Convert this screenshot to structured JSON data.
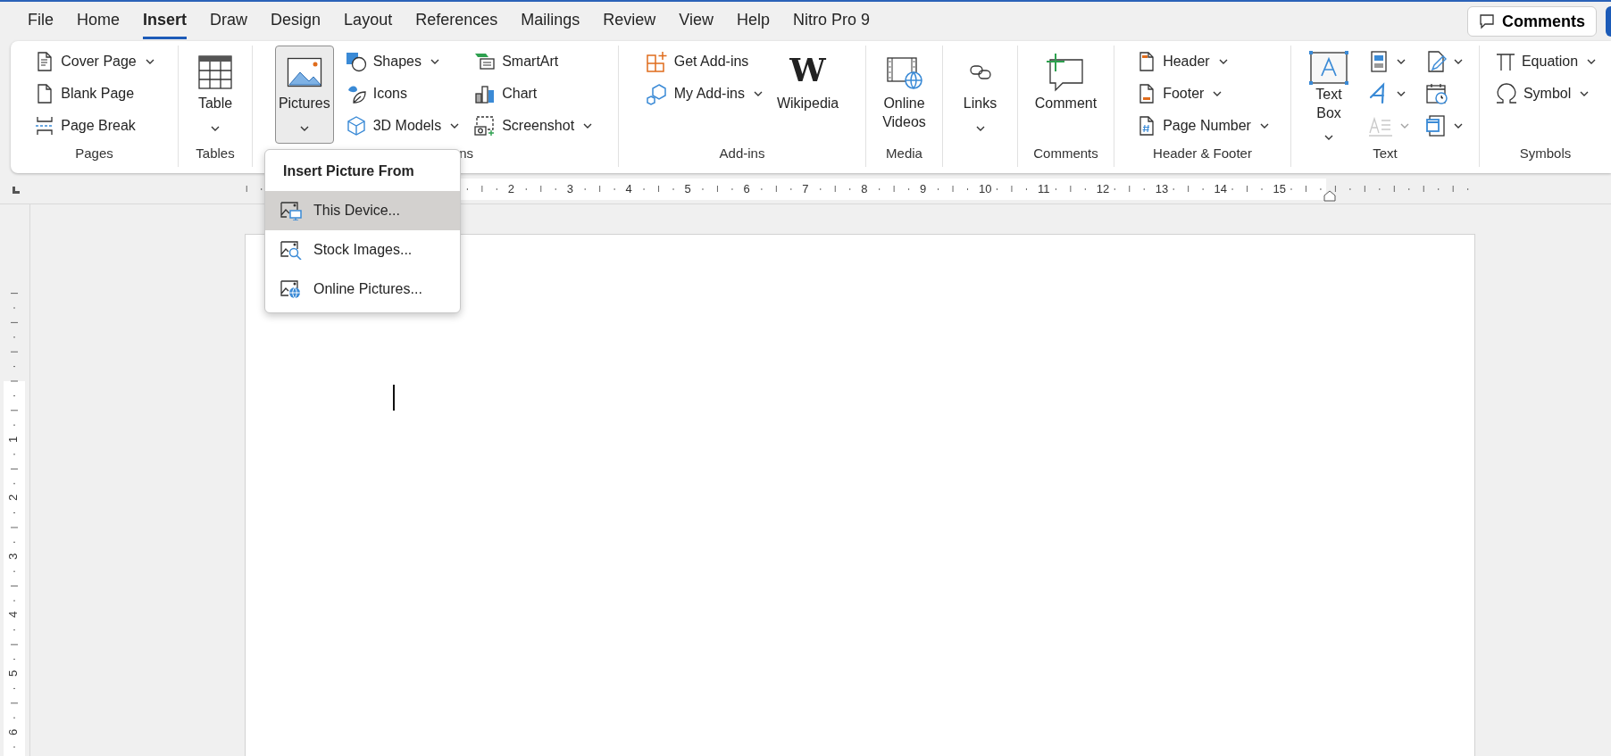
{
  "tabs": [
    {
      "label": "File",
      "selected": false
    },
    {
      "label": "Home",
      "selected": false
    },
    {
      "label": "Insert",
      "selected": true
    },
    {
      "label": "Draw",
      "selected": false
    },
    {
      "label": "Design",
      "selected": false
    },
    {
      "label": "Layout",
      "selected": false
    },
    {
      "label": "References",
      "selected": false
    },
    {
      "label": "Mailings",
      "selected": false
    },
    {
      "label": "Review",
      "selected": false
    },
    {
      "label": "View",
      "selected": false
    },
    {
      "label": "Help",
      "selected": false
    },
    {
      "label": "Nitro Pro 9",
      "selected": false
    }
  ],
  "comments_button": "Comments",
  "ribbon_groups": [
    {
      "label": "Pages",
      "columns": [
        [
          {
            "kind": "small",
            "label": "Cover Page",
            "dropdown": true
          },
          {
            "kind": "small",
            "label": "Blank Page",
            "dropdown": false
          },
          {
            "kind": "small",
            "label": "Page Break",
            "dropdown": false
          }
        ]
      ]
    },
    {
      "label": "Tables",
      "columns": [
        [
          {
            "kind": "large",
            "label": "Table",
            "dropdown": true,
            "pressed": false
          }
        ]
      ]
    },
    {
      "label": "ns",
      "columns": [
        [
          {
            "kind": "large",
            "label": "Pictures",
            "dropdown": true,
            "pressed": true
          }
        ],
        [
          {
            "kind": "small",
            "label": "Shapes",
            "dropdown": true
          },
          {
            "kind": "small",
            "label": "Icons",
            "dropdown": false
          },
          {
            "kind": "small",
            "label": "3D Models",
            "dropdown": true
          }
        ],
        [
          {
            "kind": "small",
            "label": "SmartArt",
            "dropdown": false
          },
          {
            "kind": "small",
            "label": "Chart",
            "dropdown": false
          },
          {
            "kind": "small",
            "label": "Screenshot",
            "dropdown": true
          }
        ]
      ]
    },
    {
      "label": "Add-ins",
      "columns": [
        [
          {
            "kind": "small",
            "label": "Get Add-ins",
            "dropdown": false
          },
          {
            "kind": "small",
            "label": "My Add-ins",
            "dropdown": true
          }
        ],
        [
          {
            "kind": "large",
            "label": "Wikipedia",
            "logo": "W",
            "dropdown": false,
            "pressed": false
          }
        ]
      ]
    },
    {
      "label": "Media",
      "columns": [
        [
          {
            "kind": "large",
            "label": "Online Videos",
            "dropdown": false,
            "pressed": false
          }
        ]
      ]
    },
    {
      "columns": [
        [
          {
            "kind": "large",
            "label": "Links",
            "dropdown": true,
            "pressed": false
          }
        ]
      ]
    },
    {
      "label": "Comments",
      "columns": [
        [
          {
            "kind": "large",
            "label": "Comment",
            "dropdown": false,
            "pressed": false
          }
        ]
      ]
    },
    {
      "label": "Header & Footer",
      "columns": [
        [
          {
            "kind": "small",
            "label": "Header",
            "dropdown": true
          },
          {
            "kind": "small",
            "label": "Footer",
            "dropdown": true
          },
          {
            "kind": "small",
            "label": "Page Number",
            "dropdown": true
          }
        ]
      ]
    },
    {
      "label": "Text",
      "columns": [
        [
          {
            "kind": "large",
            "label": "Text Box",
            "dropdown": true,
            "pressed": false
          }
        ],
        [
          {
            "kind": "icon",
            "dropdown": true,
            "disabled": false
          },
          {
            "kind": "icon",
            "dropdown": true,
            "disabled": false
          },
          {
            "kind": "icon",
            "dropdown": true,
            "disabled": true
          }
        ],
        [
          {
            "kind": "icon",
            "dropdown": true,
            "disabled": false
          },
          {
            "kind": "icon",
            "dropdown": false,
            "disabled": false
          },
          {
            "kind": "icon",
            "dropdown": true,
            "disabled": false
          }
        ]
      ]
    },
    {
      "label": "Symbols",
      "columns": [
        [
          {
            "kind": "small",
            "label": "Equation",
            "dropdown": true
          },
          {
            "kind": "small",
            "label": "Symbol",
            "dropdown": true
          }
        ]
      ]
    }
  ],
  "picture_menu": {
    "title": "Insert Picture From",
    "items": [
      {
        "label": "This Device...",
        "selected": true
      },
      {
        "label": "Stock Images...",
        "selected": false
      },
      {
        "label": "Online Pictures...",
        "selected": false
      }
    ]
  },
  "horizontal_ruler": [
    "2",
    "3",
    "4",
    "5",
    "6",
    "7",
    "8",
    "9",
    "10",
    "11",
    "12",
    "13",
    "14",
    "15"
  ],
  "vertical_ruler": [
    "1",
    "2",
    "3",
    "4",
    "5",
    "6"
  ]
}
